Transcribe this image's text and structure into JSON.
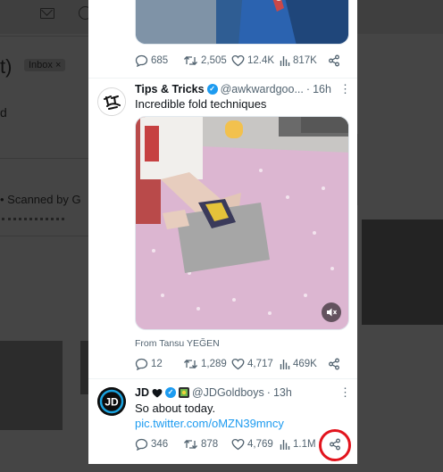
{
  "background": {
    "title_fragment": "t)",
    "inbox_chip": "Inbox ×",
    "scanned_text": "•  Scanned by G",
    "mark_fragment": "d"
  },
  "colors": {
    "link": "#1d9bf0",
    "highlight_ring": "#e2141d",
    "verified": "#1d9bf0"
  },
  "tweets": [
    {
      "stats": {
        "replies": "685",
        "retweets": "2,505",
        "likes": "12.4K",
        "views": "817K"
      }
    },
    {
      "name": "Tips & Tricks",
      "handle": "@awkwardgoo...",
      "dot": "·",
      "time": "16h",
      "text": "Incredible fold techniques",
      "media_credit": "From Tansu YEĞEN",
      "stats": {
        "replies": "12",
        "retweets": "1,289",
        "likes": "4,717",
        "views": "469K"
      }
    },
    {
      "name": "JD",
      "handle": "@JDGoldboys",
      "dot": "·",
      "time": "13h",
      "text": "So about today. ",
      "link_text": "pic.twitter.com/oMZN39mncy",
      "stats": {
        "replies": "346",
        "retweets": "878",
        "likes": "4,769",
        "views": "1.1M"
      }
    }
  ],
  "icons": {
    "reply": "reply-icon",
    "retweet": "retweet-icon",
    "like": "like-icon",
    "views": "views-icon",
    "share": "share-icon",
    "more": "more-icon",
    "mute": "mute-icon",
    "verified": "verified-badge-icon"
  }
}
